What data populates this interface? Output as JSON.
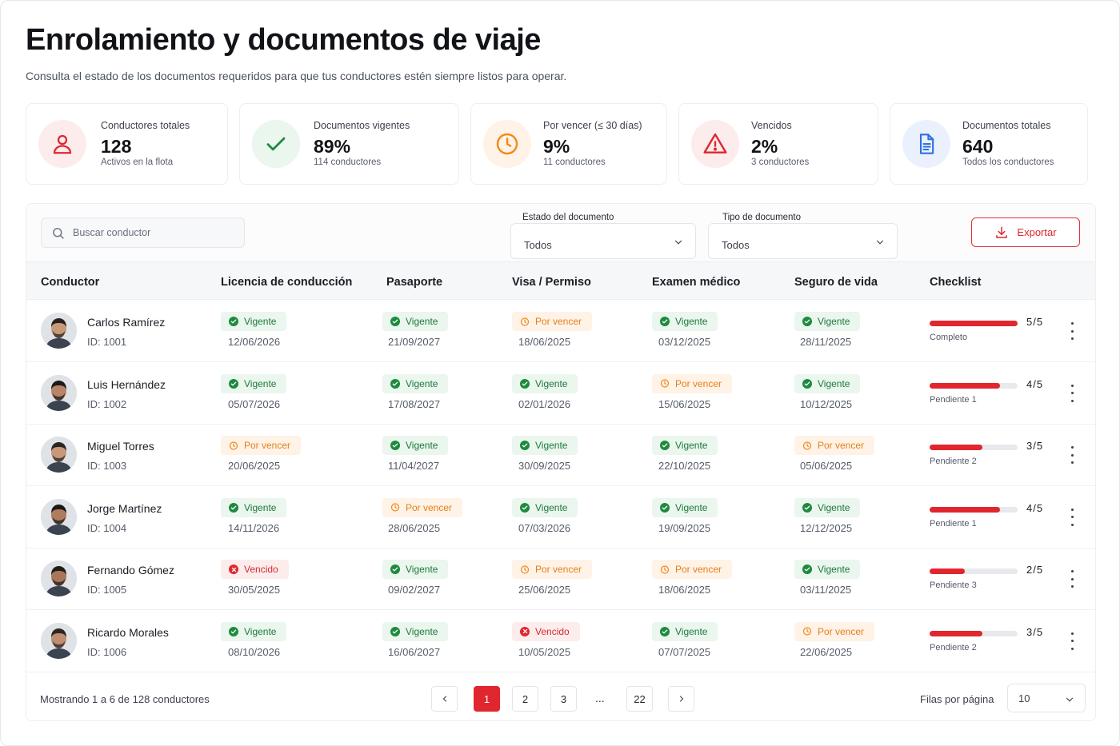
{
  "header": {
    "title": "Enrolamiento y documentos de viaje",
    "subtitle": "Consulta el estado de los documentos requeridos para que tus conductores estén siempre listos para operar."
  },
  "stats": [
    {
      "label": "Conductores totales",
      "value": "128",
      "sub": "Activos en la flota",
      "icon": "user-icon",
      "color": "#e0262e",
      "bg": "#fdecec"
    },
    {
      "label": "Documentos vigentes",
      "value": "89%",
      "sub": "114 conductores",
      "icon": "check-icon",
      "color": "#1d8a3e",
      "bg": "#eaf6ee"
    },
    {
      "label": "Por vencer (≤ 30 días)",
      "value": "9%",
      "sub": "11 conductores",
      "icon": "clock-icon",
      "color": "#ef8a1a",
      "bg": "#fff2e6"
    },
    {
      "label": "Vencidos",
      "value": "2%",
      "sub": "3 conductores",
      "icon": "warning-icon",
      "color": "#e0262e",
      "bg": "#fdecec"
    },
    {
      "label": "Documentos totales",
      "value": "640",
      "sub": "Todos los conductores",
      "icon": "document-icon",
      "color": "#2f6fe0",
      "bg": "#eaf1fd"
    }
  ],
  "toolbar": {
    "search_placeholder": "Buscar conductor",
    "estado_label": "Estado del documento",
    "estado_value": "Todos",
    "tipo_label": "Tipo de documento",
    "tipo_value": "Todos",
    "export_label": "Exportar"
  },
  "table": {
    "headers": [
      "Conductor",
      "Licencia de conducción",
      "Pasaporte",
      "Visa / Permiso",
      "Examen médico",
      "Seguro de vida",
      "Checklist"
    ],
    "rows": [
      {
        "name": "Carlos Ramírez",
        "id": "ID: 1001",
        "docs": [
          [
            "Vigente",
            "12/06/2026"
          ],
          [
            "Vigente",
            "21/09/2027"
          ],
          [
            "Por vencer",
            "18/06/2025"
          ],
          [
            "Vigente",
            "03/12/2025"
          ],
          [
            "Vigente",
            "28/11/2025"
          ]
        ],
        "checklist": "5/5",
        "progress": 1.0,
        "checklist_label": "Completo"
      },
      {
        "name": "Luis Hernández",
        "id": "ID: 1002",
        "docs": [
          [
            "Vigente",
            "05/07/2026"
          ],
          [
            "Vigente",
            "17/08/2027"
          ],
          [
            "Vigente",
            "02/01/2026"
          ],
          [
            "Por vencer",
            "15/06/2025"
          ],
          [
            "Vigente",
            "10/12/2025"
          ]
        ],
        "checklist": "4/5",
        "progress": 0.8,
        "checklist_label": "Pendiente 1"
      },
      {
        "name": "Miguel Torres",
        "id": "ID: 1003",
        "docs": [
          [
            "Por vencer",
            "20/06/2025"
          ],
          [
            "Vigente",
            "11/04/2027"
          ],
          [
            "Vigente",
            "30/09/2025"
          ],
          [
            "Vigente",
            "22/10/2025"
          ],
          [
            "Por vencer",
            "05/06/2025"
          ]
        ],
        "checklist": "3/5",
        "progress": 0.6,
        "checklist_label": "Pendiente 2"
      },
      {
        "name": "Jorge Martínez",
        "id": "ID: 1004",
        "docs": [
          [
            "Vigente",
            "14/11/2026"
          ],
          [
            "Por vencer",
            "28/06/2025"
          ],
          [
            "Vigente",
            "07/03/2026"
          ],
          [
            "Vigente",
            "19/09/2025"
          ],
          [
            "Vigente",
            "12/12/2025"
          ]
        ],
        "checklist": "4/5",
        "progress": 0.8,
        "checklist_label": "Pendiente 1"
      },
      {
        "name": "Fernando Gómez",
        "id": "ID: 1005",
        "docs": [
          [
            "Vencido",
            "30/05/2025"
          ],
          [
            "Vigente",
            "09/02/2027"
          ],
          [
            "Por vencer",
            "25/06/2025"
          ],
          [
            "Por vencer",
            "18/06/2025"
          ],
          [
            "Vigente",
            "03/11/2025"
          ]
        ],
        "checklist": "2/5",
        "progress": 0.4,
        "checklist_label": "Pendiente 3"
      },
      {
        "name": "Ricardo Morales",
        "id": "ID: 1006",
        "docs": [
          [
            "Vigente",
            "08/10/2026"
          ],
          [
            "Vigente",
            "16/06/2027"
          ],
          [
            "Vencido",
            "10/05/2025"
          ],
          [
            "Vigente",
            "07/07/2025"
          ],
          [
            "Por vencer",
            "22/06/2025"
          ]
        ],
        "checklist": "3/5",
        "progress": 0.6,
        "checklist_label": "Pendiente 2"
      }
    ]
  },
  "footer": {
    "showing": "Mostrando 1 a 6 de 128 conductores",
    "pages": [
      "1",
      "2",
      "3",
      "22"
    ],
    "ellipsis": "...",
    "active_page": "1",
    "rows_per_page_label": "Filas por página",
    "rows_per_page_value": "10"
  },
  "colors": {
    "accent": "#e0262e",
    "vigente": "#1d7a3a",
    "por_vencer": "#e5801a",
    "vencido": "#d32b33"
  }
}
